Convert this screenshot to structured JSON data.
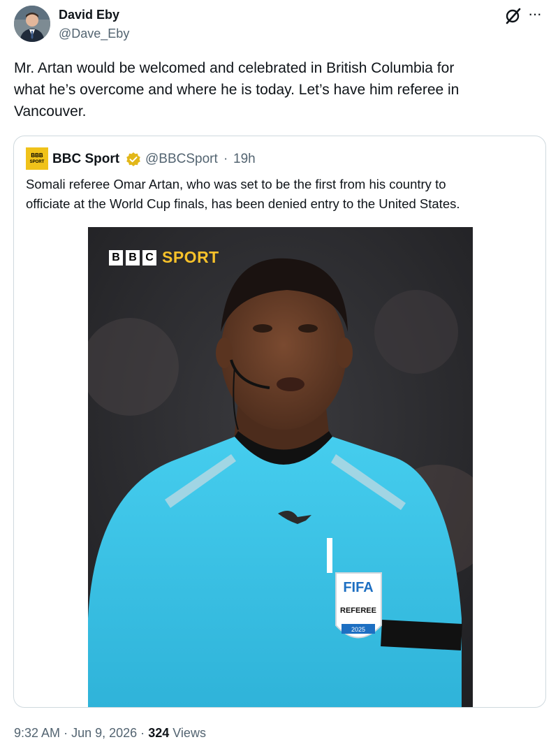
{
  "author": {
    "name": "David Eby",
    "handle": "@Dave_Eby",
    "avatar_icon": "user-avatar-photo"
  },
  "header_icons": {
    "grok": "grok-icon",
    "more": "more-options-icon",
    "more_glyph": "···"
  },
  "tweet": {
    "text": "Mr. Artan would be welcomed and celebrated in British Columbia for\nwhat he’s overcome and where he is today. Let’s have him referee in\nVancouver."
  },
  "quote": {
    "name": "BBC Sport",
    "handle": "@BBCSport",
    "separator": "·",
    "time": "19h",
    "logo_text_top": "BBB",
    "logo_text_bottom": "SPORT",
    "text": "Somali referee Omar Artan, who was set to be the first from his country to\nofficiate at the World Cup finals, has been denied entry to the United States.",
    "verified_color": "#e2b719"
  },
  "media": {
    "watermark": {
      "letters": [
        "B",
        "B",
        "C"
      ],
      "sport": "SPORT"
    },
    "badge": {
      "line1": "FIFA",
      "line2": "REFEREE",
      "line3": "2025"
    }
  },
  "footer": {
    "time": "9:32 AM",
    "date": "Jun 9, 2026",
    "sep": "·",
    "views_count": "324",
    "views_label": "Views"
  },
  "colors": {
    "accent_blue": "#1d9bf0",
    "secondary_text": "#536471",
    "bbc_yellow": "#f6c12a",
    "shirt": "#3ec6e8"
  }
}
